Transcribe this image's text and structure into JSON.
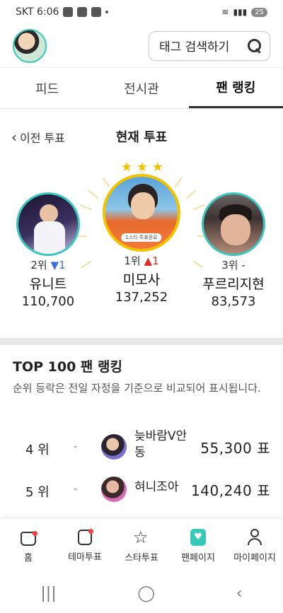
{
  "status": {
    "carrier_time": "SKT 6:06",
    "battery": "25"
  },
  "header": {
    "search_label": "태그 검색하기"
  },
  "tabs": [
    {
      "label": "피드"
    },
    {
      "label": "전시관"
    },
    {
      "label": "팬 랭킹"
    }
  ],
  "vote_nav": {
    "prev_label": "이전 투표",
    "current_label": "현재 투표"
  },
  "podium": {
    "first": {
      "rank": "1위",
      "change_icon": "▲",
      "change": "1",
      "name": "미모사",
      "votes": "137,252",
      "badge": "1스타 투표완료"
    },
    "second": {
      "rank": "2위",
      "change_icon": "▼",
      "change": "1",
      "name": "유니트",
      "votes": "110,700"
    },
    "third": {
      "rank": "3위",
      "change": "-",
      "name": "푸르리지현",
      "votes": "83,573"
    },
    "stars": "★ ★ ★"
  },
  "top100": {
    "title": "TOP 100 팬 랭킹",
    "desc": "순위 등락은 전일 자정을 기준으로 비교되어 표시됩니다."
  },
  "list": [
    {
      "rank": "4 위",
      "change": "-",
      "name": "늦바람V안동",
      "votes": "55,300 표"
    },
    {
      "rank": "5 위",
      "change": "-",
      "name": "혀니조아",
      "votes": "140,240 표"
    }
  ],
  "bottom_nav": [
    {
      "label": "홈"
    },
    {
      "label": "테마투표"
    },
    {
      "label": "스타투표"
    },
    {
      "label": "팬페이지"
    },
    {
      "label": "마이페이지"
    }
  ],
  "colors": {
    "accent": "#3ec6c0",
    "rank_up": "#e02a2a",
    "rank_down": "#3d6fe0",
    "star": "#f2c200"
  }
}
